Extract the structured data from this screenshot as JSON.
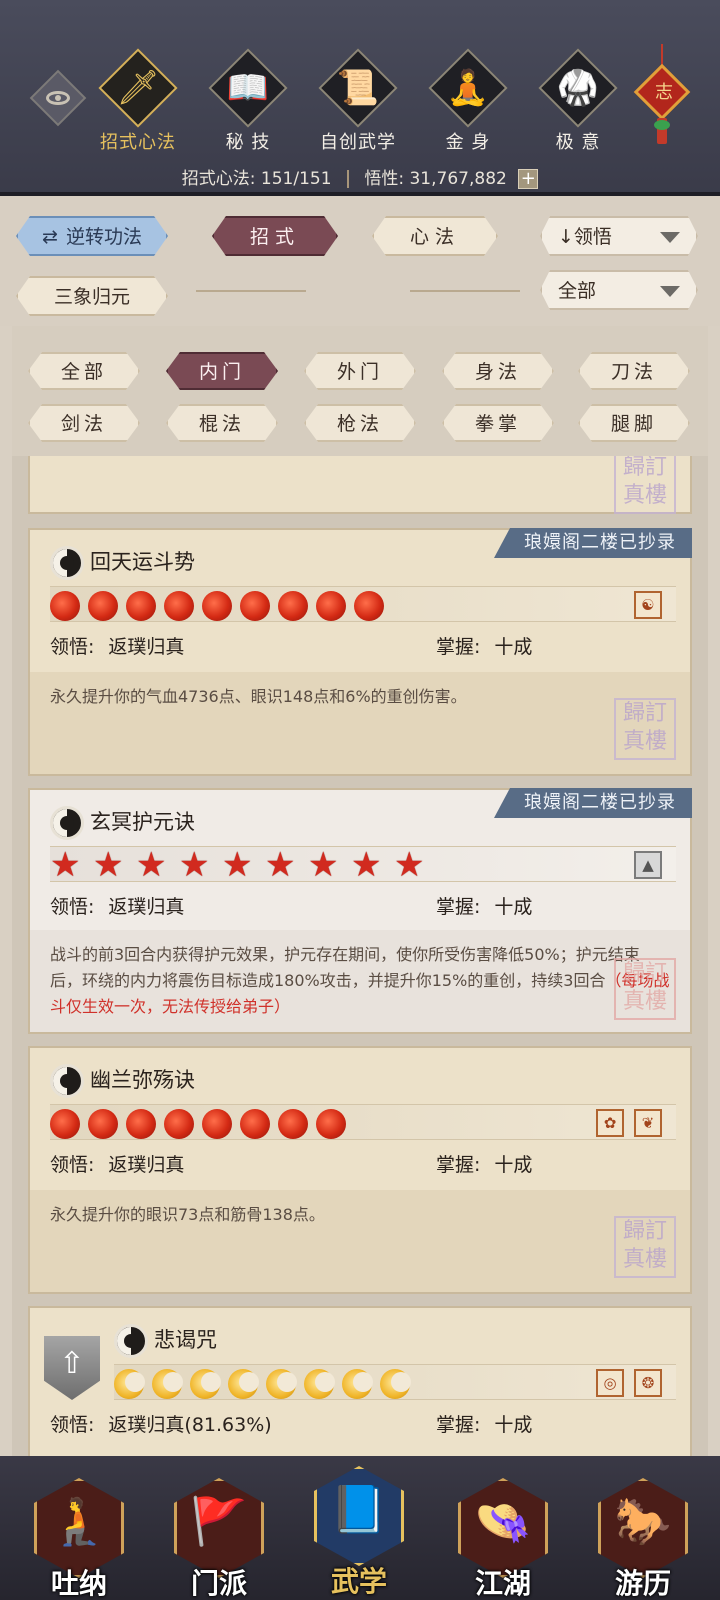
{
  "header": {
    "tabs": [
      {
        "label": "招式心法",
        "icon": "sword-icon",
        "glyph": "🗡",
        "active": true
      },
      {
        "label": "秘 技",
        "icon": "book-icon",
        "glyph": "📖",
        "active": false
      },
      {
        "label": "自创武学",
        "icon": "scroll-icon",
        "glyph": "📜",
        "active": false
      },
      {
        "label": "金 身",
        "icon": "meditation-icon",
        "glyph": "🧘",
        "active": false
      },
      {
        "label": "极 意",
        "icon": "martial-stance-icon",
        "glyph": "🥋",
        "active": false
      }
    ],
    "knot_char": "志",
    "stats": {
      "moves_label": "招式心法:",
      "moves_value": "151/151",
      "insight_label": "悟性:",
      "insight_value": "31,767,882",
      "plus": "+"
    }
  },
  "toolbar": {
    "reverse_label": "逆转功法",
    "reverse_icon": "⇄",
    "moves_tab": "招式",
    "mind_tab": "心法",
    "sort_label": "↓领悟",
    "sanxiang_label": "三象归元",
    "filter_dropdown": "全部"
  },
  "filters": [
    "全部",
    "内门",
    "外门",
    "身法",
    "刀法",
    "剑法",
    "棍法",
    "枪法",
    "拳掌",
    "腿脚"
  ],
  "active_filter": "内门",
  "seal_text": "歸訂\n真樓",
  "skills": [
    {
      "name": "回天运斗势",
      "ribbon": "琅嬛阁二楼已抄录",
      "pips": 9,
      "pip_type": "flame",
      "comprehension_label": "领悟:",
      "comprehension_value": "返璞归真",
      "mastery_label": "掌握:",
      "mastery_value": "十成",
      "description": "永久提升你的气血4736点、眼识148点和6%的重创伤害。"
    },
    {
      "name": "玄冥护元诀",
      "ribbon": "琅嬛阁二楼已抄录",
      "pips": 9,
      "pip_type": "star",
      "comprehension_label": "领悟:",
      "comprehension_value": "返璞归真",
      "mastery_label": "掌握:",
      "mastery_value": "十成",
      "description": "战斗的前3回合内获得护元效果，护元存在期间，使你所受伤害降低50%；护元结束后，环绕的内力将震伤目标造成180%攻击，并提升你15%的重创，持续3回合",
      "warning": "（每场战斗仅生效一次，无法传授给弟子）"
    },
    {
      "name": "幽兰弥殇诀",
      "pips": 8,
      "pip_type": "flame",
      "comprehension_label": "领悟:",
      "comprehension_value": "返璞归真",
      "mastery_label": "掌握:",
      "mastery_value": "十成",
      "description": "永久提升你的眼识73点和筋骨138点。"
    },
    {
      "name": "悲谒咒",
      "pips": 8,
      "pip_type": "moon",
      "comprehension_label": "领悟:",
      "comprehension_value": "返璞归真(81.63%)",
      "mastery_label": "掌握:",
      "mastery_value": "十成"
    }
  ],
  "bottom_nav": [
    {
      "label": "吐纳",
      "icon": "monk-icon",
      "glyph": "🧎",
      "active": false
    },
    {
      "label": "门派",
      "icon": "banner-icon",
      "glyph": "🚩",
      "active": false
    },
    {
      "label": "武学",
      "icon": "manual-icon",
      "glyph": "📘",
      "active": true
    },
    {
      "label": "江湖",
      "icon": "straw-hat-icon",
      "glyph": "👒",
      "active": false
    },
    {
      "label": "游历",
      "icon": "horse-icon",
      "glyph": "🐎",
      "active": false
    }
  ]
}
